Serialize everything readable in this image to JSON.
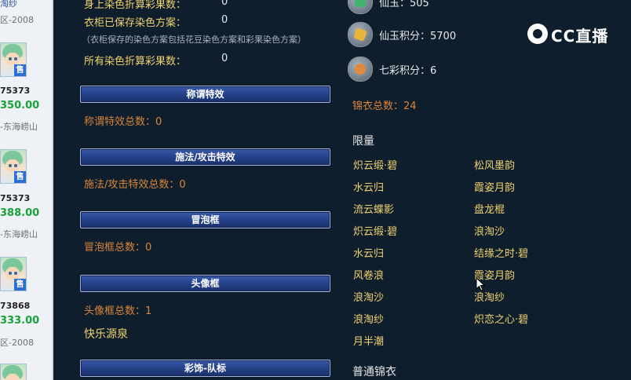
{
  "left_panel": {
    "top_text": "淘纱",
    "server_1": "区-2008",
    "listings": [
      {
        "id": "75373",
        "price": "350.00",
        "server": "-东海崂山",
        "badge": "售"
      },
      {
        "id": "75373",
        "price": "388.00",
        "server": "-东海崂山",
        "badge": "售"
      },
      {
        "id": "73868",
        "price": "333.00",
        "server": "区-2008",
        "badge": "售"
      }
    ]
  },
  "dye": {
    "partial_label": "身上染色折算彩果数：",
    "partial_value": "0",
    "wardrobe_label": "衣柜已保存染色方案：",
    "wardrobe_value": "0",
    "note": "（衣柜保存的染色方案包括花豆染色方案和彩果染色方案）",
    "total_label": "所有染色折算彩果数：",
    "total_value": "0"
  },
  "sections": {
    "title_effects": {
      "header": "称谓特效",
      "count_text": "称谓特效总数：0"
    },
    "cast_effects": {
      "header": "施法/攻击特效",
      "count_text": "施法/攻击特效总数：0"
    },
    "bubble": {
      "header": "冒泡框",
      "count_text": "冒泡框总数：0"
    },
    "avatar_frame": {
      "header": "头像框",
      "count_text": "头像框总数：1",
      "item": "快乐源泉"
    },
    "color_team": {
      "header": "彩饰-队标"
    }
  },
  "resources": {
    "xianyu": "仙玉：505",
    "xianyu_points": "仙玉积分：5700",
    "qicai_points": "七彩积分：6"
  },
  "jinyi": {
    "total_text": "锦衣总数：24",
    "limited_title": "限量",
    "limited_col1": [
      "炽云缎·碧",
      "水云归",
      "流云蝶影",
      "炽云缎·碧",
      "水云归",
      "风卷浪",
      "浪淘沙",
      "浪淘纱",
      "月半潮"
    ],
    "limited_col2": [
      "松风墨韵",
      "霞姿月韵",
      "盘龙棍",
      "浪淘沙",
      "结缘之时·碧",
      "霞姿月韵",
      "浪淘纱",
      "炽恋之心·碧"
    ],
    "normal_title": "普通锦衣"
  },
  "watermark": {
    "text": "CC直播"
  },
  "colors": {
    "background": "#0f1e2d",
    "gold_text": "#f0d270",
    "orange_text": "#d98638",
    "section_bar": "#25428a",
    "price_green": "#1aa23a"
  },
  "icons": [
    "xianyu-icon",
    "xianyu-points-icon",
    "qicai-points-icon",
    "cc-live-logo-icon",
    "mouse-cursor-icon",
    "sold-badge-icon"
  ]
}
